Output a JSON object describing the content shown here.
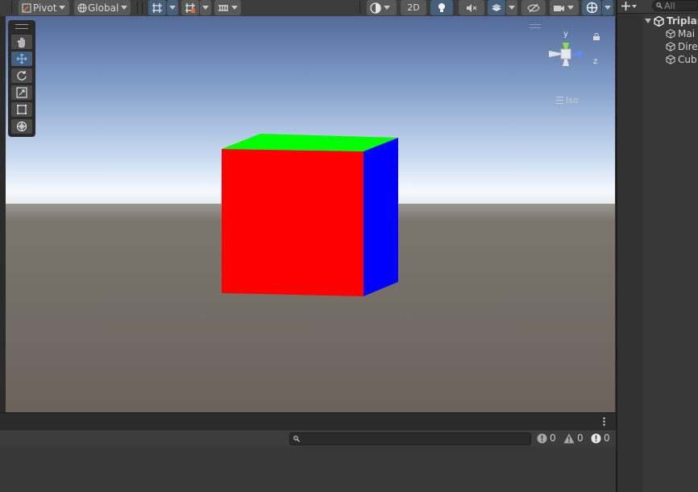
{
  "toolbar": {
    "pivot_label": "Pivot",
    "global_label": "Global",
    "mode_2d_label": "2D"
  },
  "scene": {
    "gizmo": {
      "y_label": "y",
      "z_label": "z"
    },
    "projection_label": "Iso",
    "cube_colors": {
      "front": "#ff0000",
      "top": "#00ff00",
      "side": "#0000ff"
    }
  },
  "console": {
    "error_count": "0",
    "warning_count": "0",
    "log_count": "0"
  },
  "hierarchy": {
    "search_placeholder": "All",
    "scene_name": "Triplan",
    "items": [
      {
        "label": "Mai"
      },
      {
        "label": "Dire"
      },
      {
        "label": "Cub"
      }
    ]
  }
}
